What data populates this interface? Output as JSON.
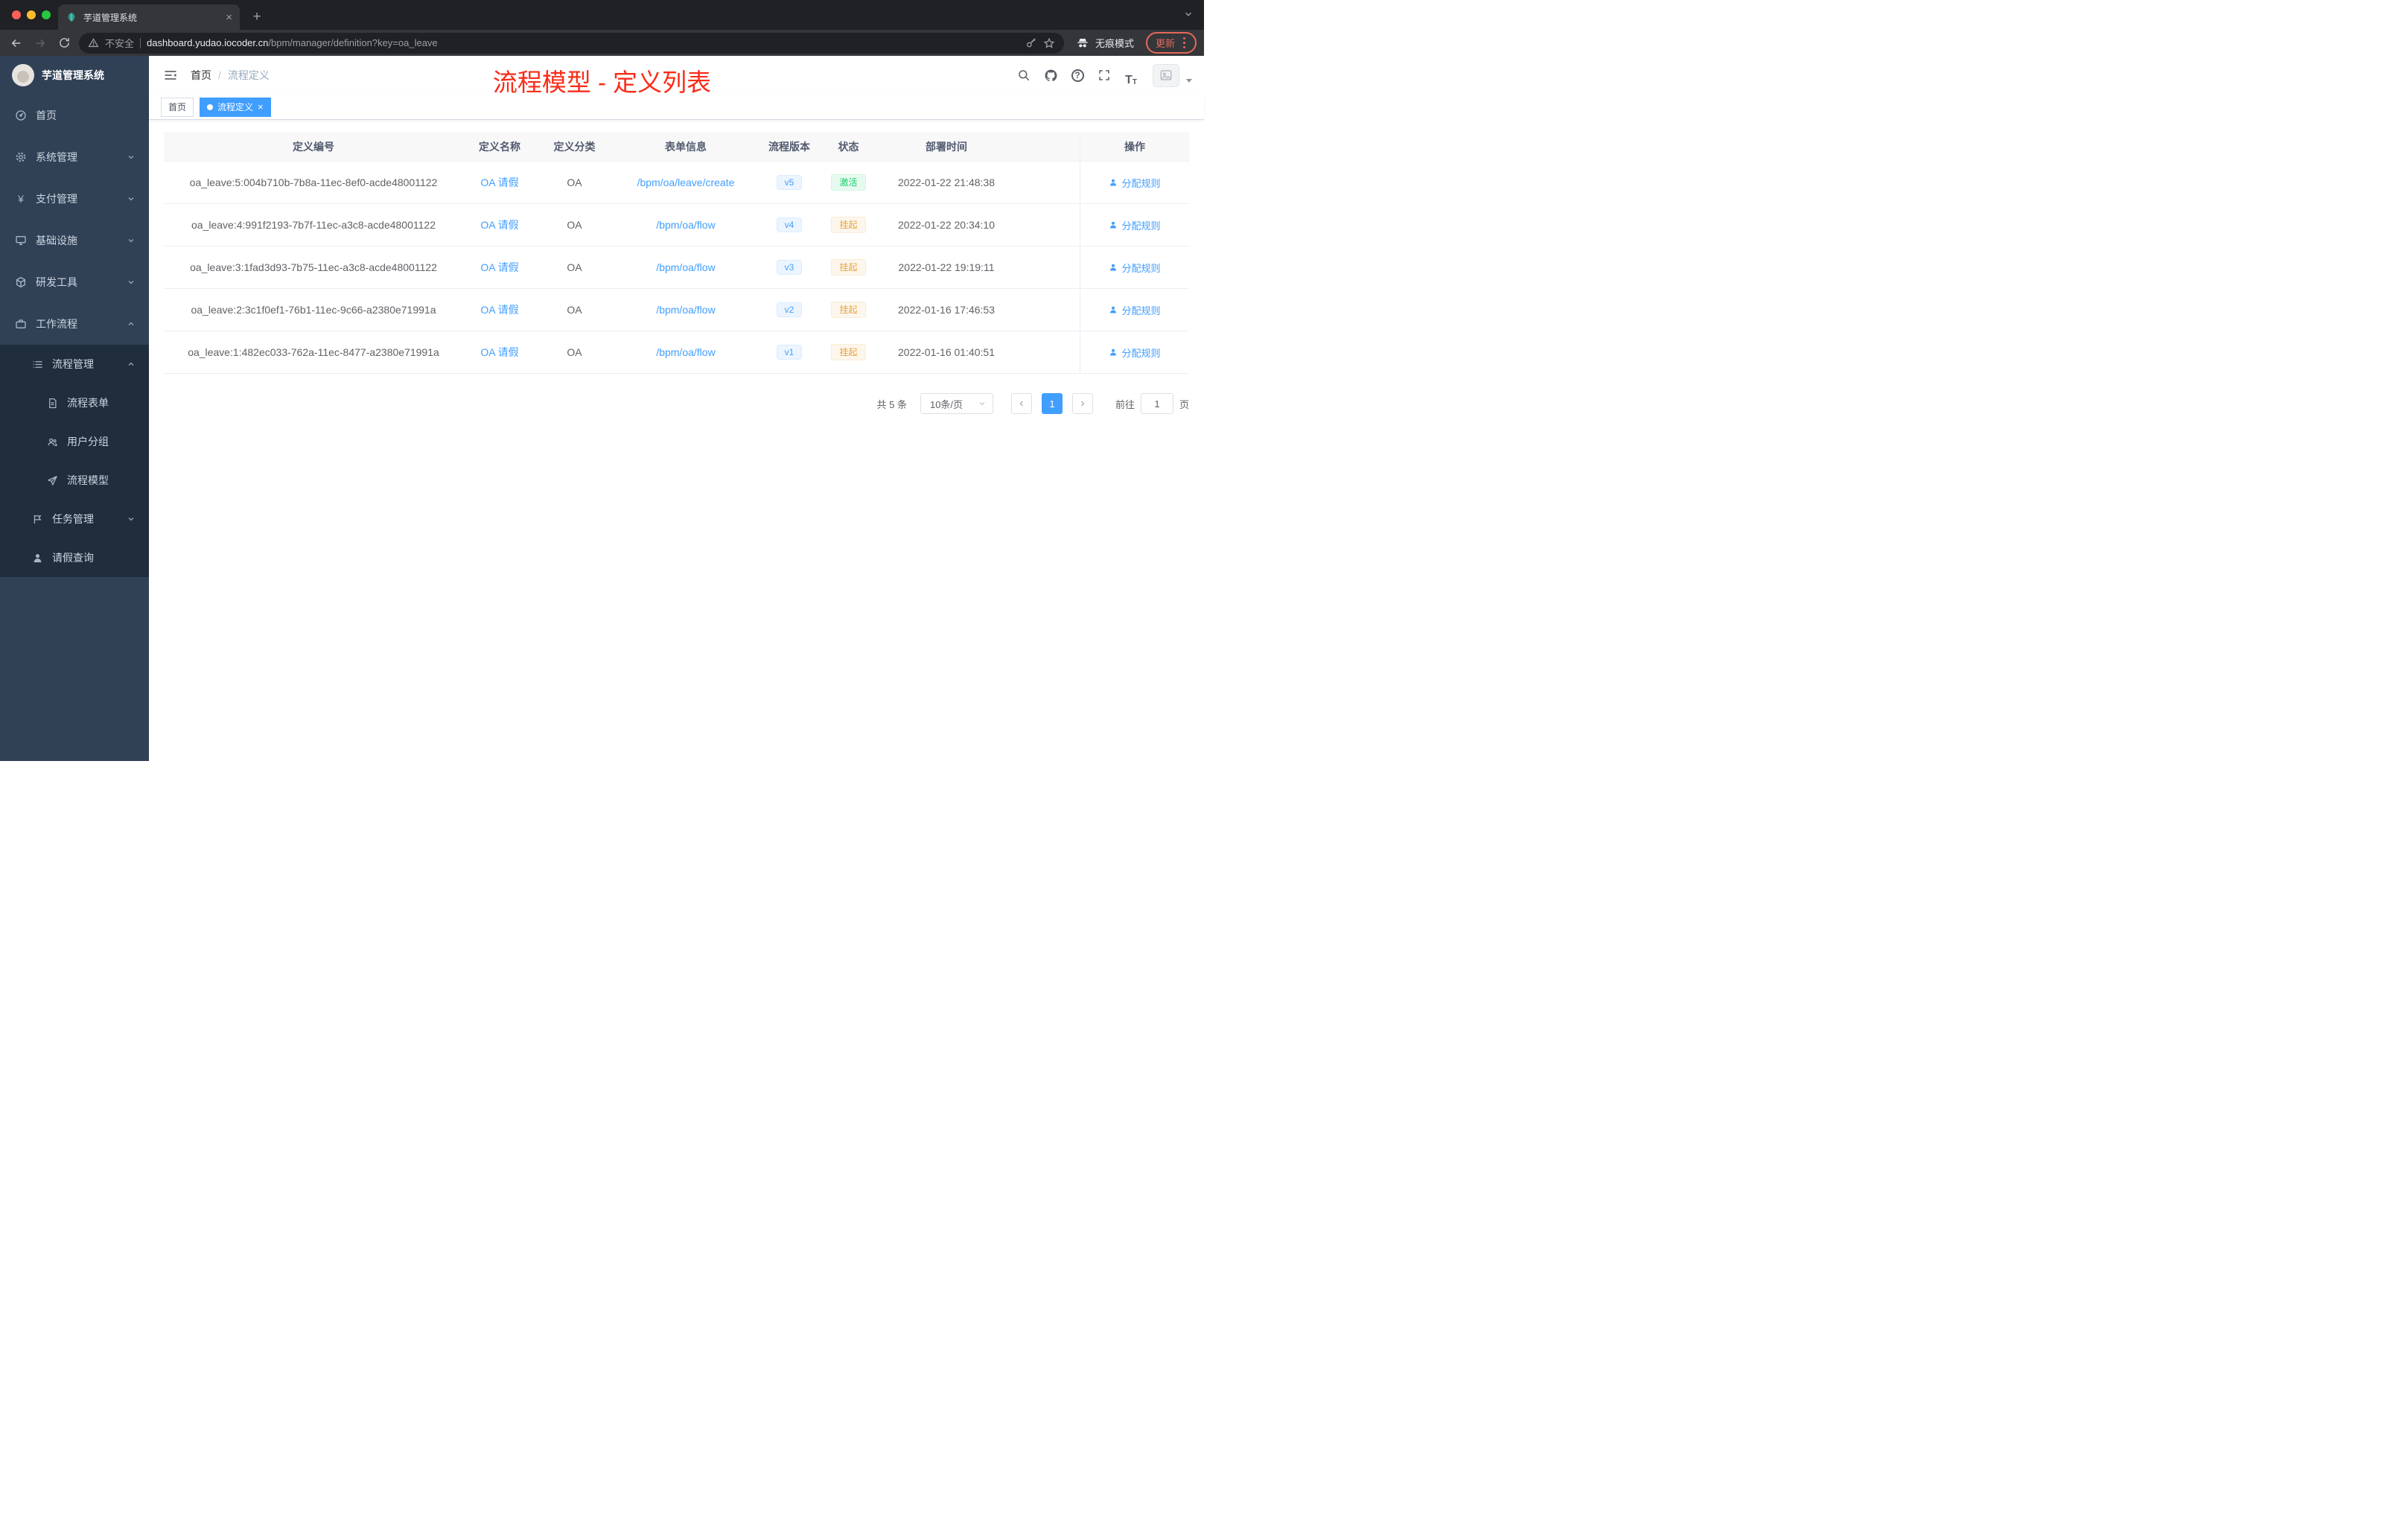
{
  "colors": {
    "accent": "#409eff",
    "annotation_red": "#fa2c19",
    "sidebar_bg": "#304156",
    "submenu_bg": "#1f2d3d",
    "status_active_text": "#13ce66",
    "status_active_bg": "#e7faf0",
    "status_suspended_text": "#e6a23c",
    "status_suspended_bg": "#fdf6ec",
    "version_badge_text": "#409eff",
    "version_badge_bg": "#ecf5ff"
  },
  "browser": {
    "tab_title": "芋道管理系统",
    "security_label": "不安全",
    "url_host": "dashboard.yudao.iocoder.cn",
    "url_path": "/bpm/manager/definition?key=oa_leave",
    "incognito_label": "无痕模式",
    "update_label": "更新"
  },
  "sidebar": {
    "logo_title": "芋道管理系统",
    "menu": [
      {
        "label": "首页"
      },
      {
        "label": "系统管理"
      },
      {
        "label": "支付管理"
      },
      {
        "label": "基础设施"
      },
      {
        "label": "研发工具"
      },
      {
        "label": "工作流程"
      }
    ],
    "workflow": {
      "process_management": "流程管理",
      "process_children": [
        "流程表单",
        "用户分组",
        "流程模型"
      ],
      "task_management": "任务管理",
      "leave_query": "请假查询"
    }
  },
  "header": {
    "breadcrumb_home": "首页",
    "breadcrumb_current": "流程定义",
    "annotation": "流程模型 - 定义列表"
  },
  "tags": {
    "home": "首页",
    "current": "流程定义"
  },
  "table": {
    "columns": [
      "定义编号",
      "定义名称",
      "定义分类",
      "表单信息",
      "流程版本",
      "状态",
      "部署时间",
      "操作"
    ],
    "rows": [
      {
        "id": "oa_leave:5:004b710b-7b8a-11ec-8ef0-acde48001122",
        "name": "OA 请假",
        "category": "OA",
        "form": "/bpm/oa/leave/create",
        "version": "v5",
        "status": "激活",
        "deployed": "2022-01-22 21:48:38",
        "action": "分配规则"
      },
      {
        "id": "oa_leave:4:991f2193-7b7f-11ec-a3c8-acde48001122",
        "name": "OA 请假",
        "category": "OA",
        "form": "/bpm/oa/flow",
        "version": "v4",
        "status": "挂起",
        "deployed": "2022-01-22 20:34:10",
        "action": "分配规则"
      },
      {
        "id": "oa_leave:3:1fad3d93-7b75-11ec-a3c8-acde48001122",
        "name": "OA 请假",
        "category": "OA",
        "form": "/bpm/oa/flow",
        "version": "v3",
        "status": "挂起",
        "deployed": "2022-01-22 19:19:11",
        "action": "分配规则"
      },
      {
        "id": "oa_leave:2:3c1f0ef1-76b1-11ec-9c66-a2380e71991a",
        "name": "OA 请假",
        "category": "OA",
        "form": "/bpm/oa/flow",
        "version": "v2",
        "status": "挂起",
        "deployed": "2022-01-16 17:46:53",
        "action": "分配规则"
      },
      {
        "id": "oa_leave:1:482ec033-762a-11ec-8477-a2380e71991a",
        "name": "OA 请假",
        "category": "OA",
        "form": "/bpm/oa/flow",
        "version": "v1",
        "status": "挂起",
        "deployed": "2022-01-16 01:40:51",
        "action": "分配规则"
      }
    ]
  },
  "pagination": {
    "total": "共 5 条",
    "page_size": "10条/页",
    "page": "1",
    "goto_label": "前往",
    "goto_value": "1",
    "page_unit": "页"
  }
}
